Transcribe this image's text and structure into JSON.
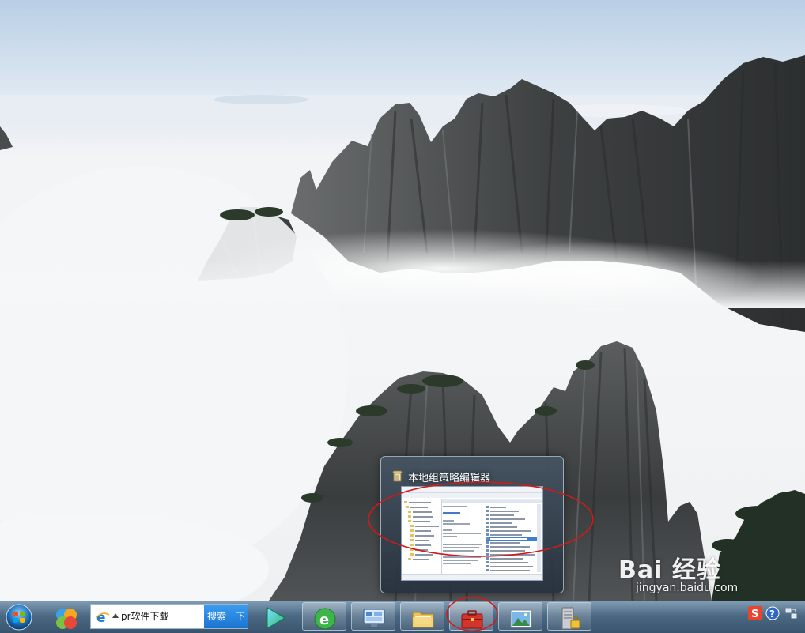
{
  "preview": {
    "title": "本地组策略编辑器"
  },
  "search": {
    "value": "pr软件下载",
    "button_label": "搜索一下"
  },
  "taskbar": {
    "buttons": [
      {
        "name": "360-browser",
        "icon": "360-icon",
        "open": false
      },
      {
        "name": "media-player",
        "icon": "play-icon",
        "open": false
      },
      {
        "name": "360-security",
        "icon": "refresh-e-icon",
        "open": true
      },
      {
        "name": "control-panel",
        "icon": "monitor-icon",
        "open": true
      },
      {
        "name": "file-explorer",
        "icon": "folder-icon",
        "open": true
      },
      {
        "name": "group-policy-editor",
        "icon": "toolbox-icon",
        "open": true,
        "active": true
      },
      {
        "name": "photo-viewer",
        "icon": "picture-icon",
        "open": true
      },
      {
        "name": "security-tool",
        "icon": "server-lock-icon",
        "open": true
      }
    ]
  },
  "tray": {
    "items": [
      "sogou-s-icon",
      "help-icon",
      "input-method-icon"
    ]
  },
  "watermark": {
    "logo": "Bai 经验",
    "url": "jingyan.baidu.com"
  },
  "colors": {
    "highlight_ellipse": "#d11a1a",
    "search_button": "#1a73d0",
    "selection": "#3d7fd6"
  }
}
